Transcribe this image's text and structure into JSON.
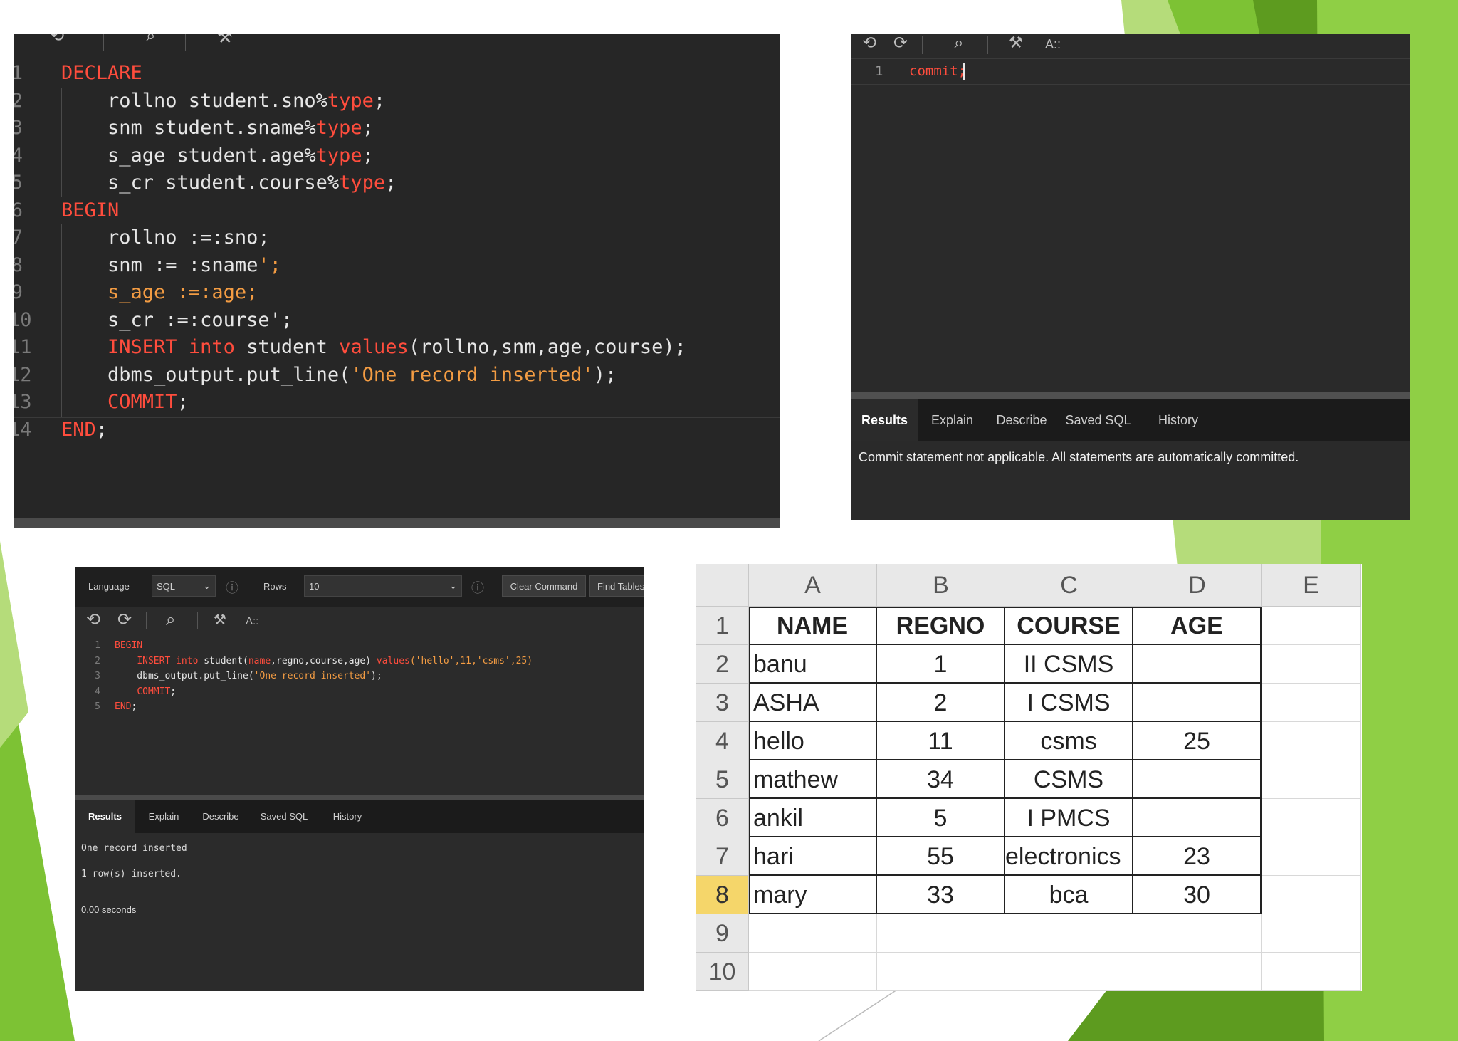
{
  "colors": {
    "green_dark": "#5d9b1f",
    "green_mid": "#7dc234",
    "green_light": "#b5dc7a",
    "editor_bg": "#2b2b2b",
    "keyword": "#ff4d3d",
    "plain": "#e6e6e6",
    "string": "#f39c43"
  },
  "top_left_editor": {
    "lines": [
      {
        "n": "1",
        "parts": [
          {
            "t": "DECLARE",
            "c": "kw"
          }
        ]
      },
      {
        "n": "2",
        "parts": [
          {
            "t": "    rollno student.sno%",
            "c": "tx"
          },
          {
            "t": "type",
            "c": "kw"
          },
          {
            "t": ";",
            "c": "tx"
          }
        ]
      },
      {
        "n": "3",
        "parts": [
          {
            "t": "    snm student.sname%",
            "c": "tx"
          },
          {
            "t": "type",
            "c": "kw"
          },
          {
            "t": ";",
            "c": "tx"
          }
        ]
      },
      {
        "n": "4",
        "parts": [
          {
            "t": "    s_age student.age%",
            "c": "tx"
          },
          {
            "t": "type",
            "c": "kw"
          },
          {
            "t": ";",
            "c": "tx"
          }
        ]
      },
      {
        "n": "5",
        "parts": [
          {
            "t": "    s_cr student.course%",
            "c": "tx"
          },
          {
            "t": "type",
            "c": "kw"
          },
          {
            "t": ";",
            "c": "tx"
          }
        ]
      },
      {
        "n": "6",
        "parts": [
          {
            "t": "BEGIN",
            "c": "kw"
          }
        ]
      },
      {
        "n": "7",
        "parts": [
          {
            "t": "    rollno :=:sno;",
            "c": "tx"
          }
        ]
      },
      {
        "n": "8",
        "parts": [
          {
            "t": "    snm := :sname",
            "c": "tx"
          },
          {
            "t": "';",
            "c": "or"
          }
        ]
      },
      {
        "n": "9",
        "parts": [
          {
            "t": "    s_age :=:age;",
            "c": "or"
          }
        ]
      },
      {
        "n": "10",
        "parts": [
          {
            "t": "    s_cr :=:course';",
            "c": "tx"
          }
        ]
      },
      {
        "n": "11",
        "parts": [
          {
            "t": "    ",
            "c": "tx"
          },
          {
            "t": "INSERT",
            "c": "kw"
          },
          {
            "t": " ",
            "c": "tx"
          },
          {
            "t": "into",
            "c": "kw"
          },
          {
            "t": " student ",
            "c": "tx"
          },
          {
            "t": "values",
            "c": "kw"
          },
          {
            "t": "(rollno,snm,age,course);",
            "c": "tx"
          }
        ]
      },
      {
        "n": "12",
        "parts": [
          {
            "t": "    dbms_output.put_line(",
            "c": "tx"
          },
          {
            "t": "'One record inserted'",
            "c": "or"
          },
          {
            "t": ");",
            "c": "tx"
          }
        ]
      },
      {
        "n": "13",
        "parts": [
          {
            "t": "    ",
            "c": "tx"
          },
          {
            "t": "COMMIT",
            "c": "kw"
          },
          {
            "t": ";",
            "c": "tx"
          }
        ]
      },
      {
        "n": "14",
        "parts": [
          {
            "t": "END",
            "c": "kw"
          },
          {
            "t": ";",
            "c": "tx"
          }
        ]
      }
    ]
  },
  "top_right_editor": {
    "toolbar_font_label": "A::",
    "line_number": "1",
    "code": "commit;",
    "tabs": [
      "Results",
      "Explain",
      "Describe",
      "Saved SQL",
      "History"
    ],
    "active_tab": "Results",
    "message": "Commit statement not applicable. All statements are automatically committed."
  },
  "bottom_left_editor": {
    "language_label": "Language",
    "language_value": "SQL",
    "rows_label": "Rows",
    "rows_value": "10",
    "clear_command_label": "Clear Command",
    "find_tables_label": "Find Tables",
    "toolbar_font_label": "A::",
    "lines": [
      {
        "n": "1",
        "parts": [
          {
            "t": "BEGIN",
            "c": "kw"
          }
        ]
      },
      {
        "n": "2",
        "parts": [
          {
            "t": "    ",
            "c": "tx"
          },
          {
            "t": "INSERT into",
            "c": "kw"
          },
          {
            "t": " student(",
            "c": "tx"
          },
          {
            "t": "name",
            "c": "kw"
          },
          {
            "t": ",regno,course,age) ",
            "c": "tx"
          },
          {
            "t": "values",
            "c": "kw"
          },
          {
            "t": "('hello',11,'csms',25)",
            "c": "or"
          }
        ]
      },
      {
        "n": "3",
        "parts": [
          {
            "t": "    dbms_output.put_line(",
            "c": "tx"
          },
          {
            "t": "'One record inserted'",
            "c": "or"
          },
          {
            "t": ");",
            "c": "tx"
          }
        ]
      },
      {
        "n": "4",
        "parts": [
          {
            "t": "    ",
            "c": "tx"
          },
          {
            "t": "COMMIT",
            "c": "kw"
          },
          {
            "t": ";",
            "c": "tx"
          }
        ]
      },
      {
        "n": "5",
        "parts": [
          {
            "t": "END",
            "c": "kw"
          },
          {
            "t": ";",
            "c": "tx"
          }
        ]
      }
    ],
    "tabs": [
      "Results",
      "Explain",
      "Describe",
      "Saved SQL",
      "History"
    ],
    "active_tab": "Results",
    "output_lines": [
      "One record inserted",
      "1 row(s) inserted.",
      "0.00 seconds"
    ]
  },
  "spreadsheet": {
    "columns": [
      "A",
      "B",
      "C",
      "D",
      "E"
    ],
    "row_numbers": [
      "1",
      "2",
      "3",
      "4",
      "5",
      "6",
      "7",
      "8",
      "9",
      "10"
    ],
    "selected_row": "8",
    "header": [
      "NAME",
      "REGNO",
      "COURSE",
      "AGE"
    ],
    "rows": [
      [
        "banu",
        "1",
        "II CSMS",
        ""
      ],
      [
        "ASHA",
        "2",
        "I CSMS",
        ""
      ],
      [
        "hello",
        "11",
        "csms",
        "25"
      ],
      [
        "mathew",
        "34",
        "CSMS",
        ""
      ],
      [
        "ankil",
        "5",
        "I PMCS",
        ""
      ],
      [
        "hari",
        "55",
        "electronics",
        "23"
      ],
      [
        "mary",
        "33",
        "bca",
        "30"
      ]
    ]
  }
}
